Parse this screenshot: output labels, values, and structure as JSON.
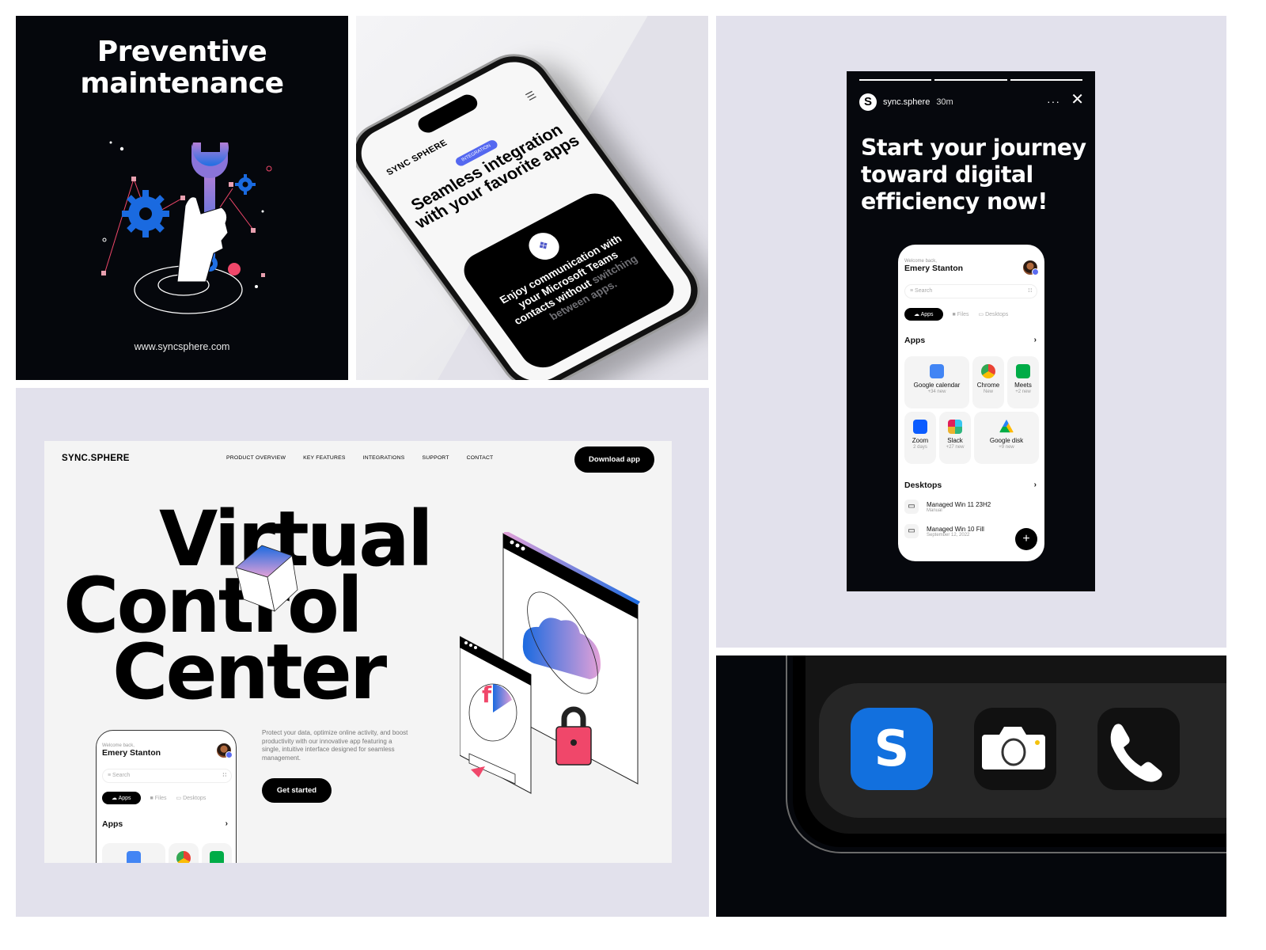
{
  "panel_maintenance": {
    "title_line1": "Preventive",
    "title_line2": "maintenance",
    "url": "www.syncsphere.com",
    "illustration": "hand-holding-wrench-with-gears-icon"
  },
  "panel_integration": {
    "brand": "SYNC SPHERE",
    "menu_icon": "hamburger-menu-icon",
    "badge": "INTEGRATION",
    "headline": "Seamless integration with your favorite apps",
    "card_icon": "microsoft-teams-icon",
    "card_text_bright": "Enjoy communication with your Microsoft Teams contacts without",
    "card_text_dim": "switching between apps."
  },
  "story": {
    "account": "sync.sphere",
    "time": "30m",
    "more_icon": "more-dots-icon",
    "close_icon": "close-icon",
    "progress_segments": 3,
    "title": "Start your journey toward digital efficiency now!"
  },
  "app": {
    "welcome": "Welcome back,",
    "user_name": "Emery Stanton",
    "search_placeholder": "Search",
    "tabs": [
      {
        "label": "Apps",
        "icon": "cloud-icon",
        "active": true
      },
      {
        "label": "Files",
        "icon": "folder-icon",
        "active": false
      },
      {
        "label": "Desktops",
        "icon": "monitor-icon",
        "active": false
      }
    ],
    "apps_heading": "Apps",
    "apps": [
      {
        "name": "Google calendar",
        "status": "+34 new",
        "color": "#4285f4"
      },
      {
        "name": "Chrome",
        "status": "New",
        "color": "#ea4335"
      },
      {
        "name": "Meets",
        "status": "+2 new",
        "color": "#00ac47"
      },
      {
        "name": "Zoom",
        "status": "2 days",
        "color": "#0b5cff"
      },
      {
        "name": "Slack",
        "status": "+27 new",
        "color": "#e01e5a"
      },
      {
        "name": "Google disk",
        "status": "+9 new",
        "color": "#ffba00"
      }
    ],
    "desktops_heading": "Desktops",
    "desktops": [
      {
        "name": "Managed Win 11 23H2",
        "status": "Manual"
      },
      {
        "name": "Managed Win 10 Fill",
        "status": "September 12, 2022"
      }
    ],
    "fab_label": "+"
  },
  "landing": {
    "brand": "SYNC.SPHERE",
    "nav": [
      "PRODUCT OVERVIEW",
      "KEY FEATURES",
      "INTEGRATIONS",
      "SUPPORT",
      "CONTACT"
    ],
    "download_button": "Download app",
    "hero_line1": "Virtual",
    "hero_line2": "Control",
    "hero_line3": "Center",
    "description": "Protect your data, optimize online activity, and boost productivity with our innovative app featuring a single, intuitive interface designed for seamless management.",
    "cta_button": "Get started"
  },
  "dock": {
    "apps": [
      {
        "name": "sync-sphere-app",
        "glyph": "S",
        "color": "#1270de"
      },
      {
        "name": "camera-app",
        "glyph": "camera",
        "color": "#111111"
      },
      {
        "name": "phone-app",
        "glyph": "phone",
        "color": "#111111"
      }
    ]
  },
  "colors": {
    "background_lavender": "#e2e1ec",
    "dark": "#05070c",
    "accent_blue": "#1270de",
    "accent_pink": "#f0476a",
    "badge_blue": "#5468f0"
  }
}
